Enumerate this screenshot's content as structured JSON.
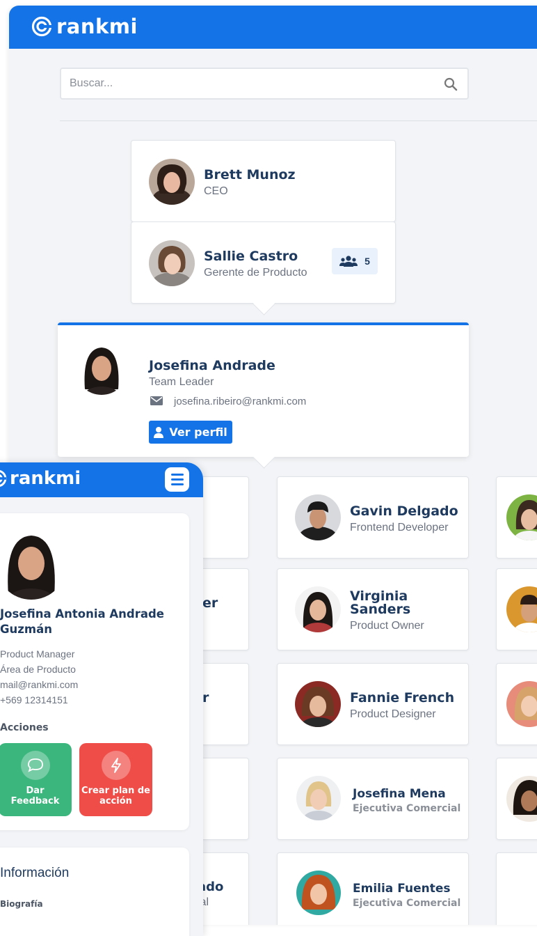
{
  "header": {
    "logo_text": "rankmi"
  },
  "search": {
    "placeholder": "Buscar..."
  },
  "chain": [
    {
      "name": "Brett Munoz",
      "role": "CEO"
    },
    {
      "name": "Sallie Castro",
      "role": "Gerente de Producto",
      "team_count": "5"
    }
  ],
  "selected": {
    "name": "Josefina Andrade",
    "role": "Team Leader",
    "email": "josefina.ribeiro@rankmi.com",
    "button_label": "Ver perfil"
  },
  "team_left": [
    {
      "name": "",
      "role": ""
    },
    {
      "name": "er",
      "role": ""
    },
    {
      "name": "r",
      "role": ""
    },
    {
      "name": "",
      "role": ""
    },
    {
      "name": "ado",
      "role": "ial"
    }
  ],
  "team_center": [
    {
      "name": "Gavin Delgado",
      "role": "Frontend Developer"
    },
    {
      "name": "Virginia Sanders",
      "role": "Product Owner"
    },
    {
      "name": "Fannie French",
      "role": "Product Designer"
    },
    {
      "name": "Josefina Mena",
      "role": "Ejecutiva Comercial"
    },
    {
      "name": "Emilia Fuentes",
      "role": "Ejecutiva Comercial"
    }
  ],
  "mobile": {
    "logo_text": "rankmi",
    "profile_name": "Josefina Antonia Andrade Guzmán",
    "details": [
      "Product Manager",
      "Área de Producto",
      "mail@rankmi.com",
      "+569 12314151"
    ],
    "actions_title": "Acciones",
    "action_feedback": "Dar Feedback",
    "action_plan": "Crear plan de acción",
    "info_title": "Información",
    "bio_label": "Biografía"
  },
  "colors": {
    "primary": "#1473e6",
    "name": "#1e3a5f",
    "feedback": "#3bb67d",
    "plan": "#ef4d48"
  }
}
